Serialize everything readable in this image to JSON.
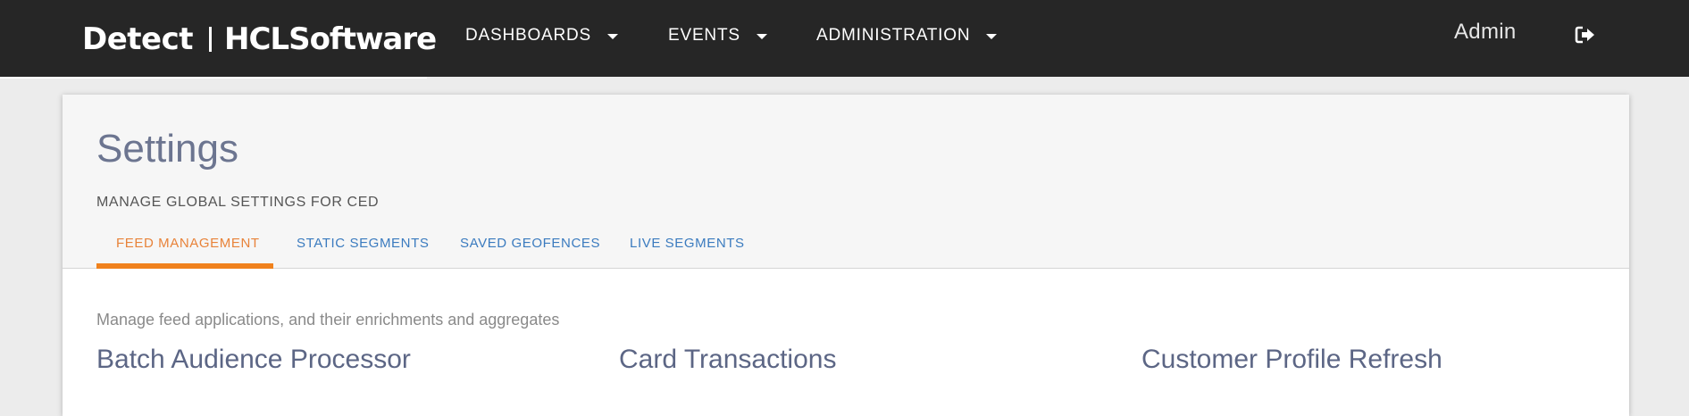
{
  "header": {
    "logo_product": "Detect",
    "logo_company": "HCLSoftware",
    "nav": [
      {
        "label": "DASHBOARDS"
      },
      {
        "label": "EVENTS"
      },
      {
        "label": "ADMINISTRATION"
      }
    ],
    "user": "Admin",
    "logout_icon": "sign-out-icon"
  },
  "settings": {
    "title": "Settings",
    "subtitle": "MANAGE GLOBAL SETTINGS FOR CED",
    "tabs": [
      {
        "label": "FEED MANAGEMENT",
        "active": true
      },
      {
        "label": "STATIC SEGMENTS",
        "active": false
      },
      {
        "label": "SAVED GEOFENCES",
        "active": false
      },
      {
        "label": "LIVE SEGMENTS",
        "active": false
      }
    ]
  },
  "feed_management": {
    "description": "Manage feed applications, and their enrichments and aggregates",
    "applications": [
      {
        "name": "Batch Audience Processor"
      },
      {
        "name": "Card Transactions"
      },
      {
        "name": "Customer Profile Refresh"
      }
    ]
  },
  "colors": {
    "topbar": "#262626",
    "active_tab": "#e8833a",
    "tab": "#3b7bbf",
    "title": "#6c7590"
  }
}
